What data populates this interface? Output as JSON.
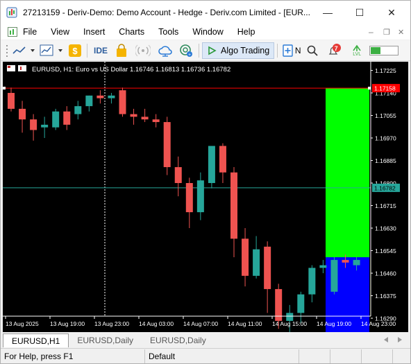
{
  "window": {
    "title": "27213159 - Deriv-Demo: Demo Account - Hedge - Deriv.com Limited - [EUR...",
    "controls": {
      "minimize": "—",
      "maximize": "☐",
      "close": "✕"
    },
    "child_controls": {
      "minimize": "–",
      "restore": "❐",
      "close": "✕"
    }
  },
  "menu": {
    "items": [
      "File",
      "View",
      "Insert",
      "Charts",
      "Tools",
      "Window",
      "Help"
    ]
  },
  "toolbar": {
    "ide_label": "IDE",
    "algo_label": "Algo Trading",
    "new_order_label": "N",
    "notification_count": "7",
    "signal_label": "LVL",
    "colors": {
      "dollar": "#f5b400",
      "cloud": "#2c7bd6",
      "notification": "#e53935",
      "signal": "#3cb043"
    }
  },
  "chart": {
    "header": "EURUSD, H1:  Euro vs US Dollar  1.16746 1.16813 1.16736 1.16782",
    "current_price": "1.16782",
    "upper_level": "1.17158",
    "lower_level": "1.16205",
    "colors": {
      "bull": "#26a69a",
      "bear": "#ef5350",
      "bg": "#000000",
      "upper": "#00ff00",
      "lower": "#0000ff",
      "price_line": "#26a69a",
      "level_line": "#ff0000"
    }
  },
  "chart_data": {
    "type": "candlestick",
    "symbol": "EURUSD",
    "timeframe": "H1",
    "y_ticks": [
      "1.17225",
      "1.17140",
      "1.17055",
      "1.16970",
      "1.16885",
      "1.16800",
      "1.16715",
      "1.16630",
      "1.16545",
      "1.16460",
      "1.16375",
      "1.16290"
    ],
    "x_ticks": [
      "13 Aug 2025",
      "13 Aug 19:00",
      "13 Aug 23:00",
      "14 Aug 03:00",
      "14 Aug 07:00",
      "14 Aug 11:00",
      "14 Aug 15:00",
      "14 Aug 19:00",
      "14 Aug 23:00"
    ],
    "ylim": [
      1.1622,
      1.1726
    ],
    "candles": [
      [
        1.1714,
        1.1716,
        1.1707,
        1.1708
      ],
      [
        1.1708,
        1.1711,
        1.1699,
        1.1704
      ],
      [
        1.1704,
        1.1706,
        1.1696,
        1.17
      ],
      [
        1.1701,
        1.1705,
        1.1697,
        1.1702
      ],
      [
        1.1701,
        1.1708,
        1.17,
        1.1707
      ],
      [
        1.1707,
        1.1709,
        1.17,
        1.1702
      ],
      [
        1.1706,
        1.1711,
        1.1704,
        1.1709
      ],
      [
        1.1709,
        1.1713,
        1.1707,
        1.1713
      ],
      [
        1.1713,
        1.1715,
        1.171,
        1.1712
      ],
      [
        1.1712,
        1.1714,
        1.171,
        1.1713
      ],
      [
        1.1715,
        1.1716,
        1.1705,
        1.1706
      ],
      [
        1.1706,
        1.1708,
        1.1702,
        1.1705
      ],
      [
        1.1705,
        1.1708,
        1.1703,
        1.1704
      ],
      [
        1.1704,
        1.1706,
        1.1701,
        1.1703
      ],
      [
        1.1703,
        1.1705,
        1.1683,
        1.1686
      ],
      [
        1.1686,
        1.169,
        1.1675,
        1.168
      ],
      [
        1.168,
        1.1682,
        1.1663,
        1.1669
      ],
      [
        1.1669,
        1.1684,
        1.1666,
        1.1681
      ],
      [
        1.168,
        1.1694,
        1.1678,
        1.1694
      ],
      [
        1.1694,
        1.1695,
        1.168,
        1.1684
      ],
      [
        1.1684,
        1.1686,
        1.1652,
        1.1659
      ],
      [
        1.1659,
        1.1663,
        1.1641,
        1.1645
      ],
      [
        1.1645,
        1.166,
        1.1644,
        1.1655
      ],
      [
        1.1656,
        1.1658,
        1.1631,
        1.164
      ],
      [
        1.164,
        1.1642,
        1.1625,
        1.1628
      ],
      [
        1.1628,
        1.1634,
        1.1622,
        1.1631
      ],
      [
        1.1631,
        1.1639,
        1.1627,
        1.1638
      ],
      [
        1.1638,
        1.1649,
        1.1635,
        1.1648
      ],
      [
        1.1648,
        1.1651,
        1.1646,
        1.1649
      ],
      [
        1.1639,
        1.1652,
        1.1638,
        1.1651
      ],
      [
        1.1651,
        1.1653,
        1.1648,
        1.165
      ],
      [
        1.1649,
        1.1652,
        1.1647,
        1.1651
      ]
    ]
  },
  "tabs": [
    "EURUSD,H1",
    "EURUSD,Daily",
    "EURUSD,Daily"
  ],
  "status": {
    "help": "For Help, press F1",
    "profile": "Default"
  }
}
